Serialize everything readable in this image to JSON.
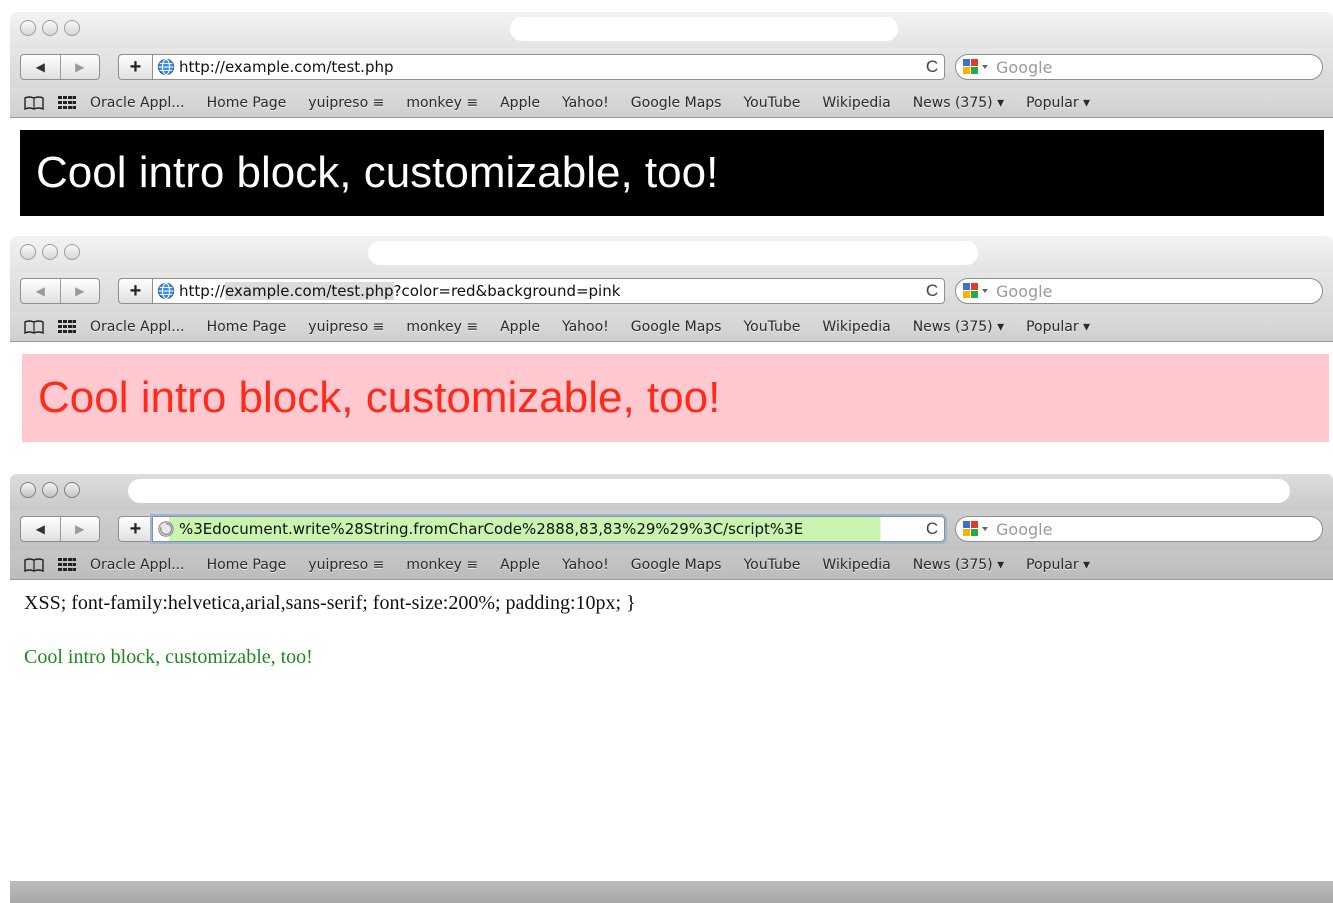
{
  "browser": {
    "nav": {
      "back": "◀",
      "forward": "▶",
      "add": "+",
      "reload": "C"
    },
    "search": {
      "placeholder": "Google"
    },
    "bookmarks": [
      "Oracle Appl...",
      "Home Page",
      "yuipreso ≡",
      "monkey ≡",
      "Apple",
      "Yahoo!",
      "Google Maps",
      "YouTube",
      "Wikipedia",
      "News (375) ▾",
      "Popular ▾"
    ]
  },
  "windows": [
    {
      "url": "http://example.com/test.php",
      "intro": "Cool intro block, customizable, too!"
    },
    {
      "url_prefix": "http://",
      "url_highlight": "example.com/test.php",
      "url_suffix": "?color=red&background=pink",
      "intro": "Cool intro block, customizable, too!"
    },
    {
      "url": "%3Edocument.write%28String.fromCharCode%2888,83,83%29%29%3C/script%3E",
      "xss_text": "XSS; font-family:helvetica,arial,sans-serif; font-size:200%; padding:10px; }",
      "intro": "Cool intro block, customizable, too!"
    }
  ],
  "colors": {
    "pink_bg": "#ffc9cf",
    "red_text": "#ff2a1a",
    "green_text": "#1d8a1d",
    "url_highlight_green": "#c9f5b0"
  },
  "icons": [
    "globe-icon",
    "google-icon",
    "book-icon",
    "grid-icon",
    "reload-icon",
    "back-arrow-icon",
    "forward-arrow-icon",
    "add-bookmark-icon"
  ]
}
